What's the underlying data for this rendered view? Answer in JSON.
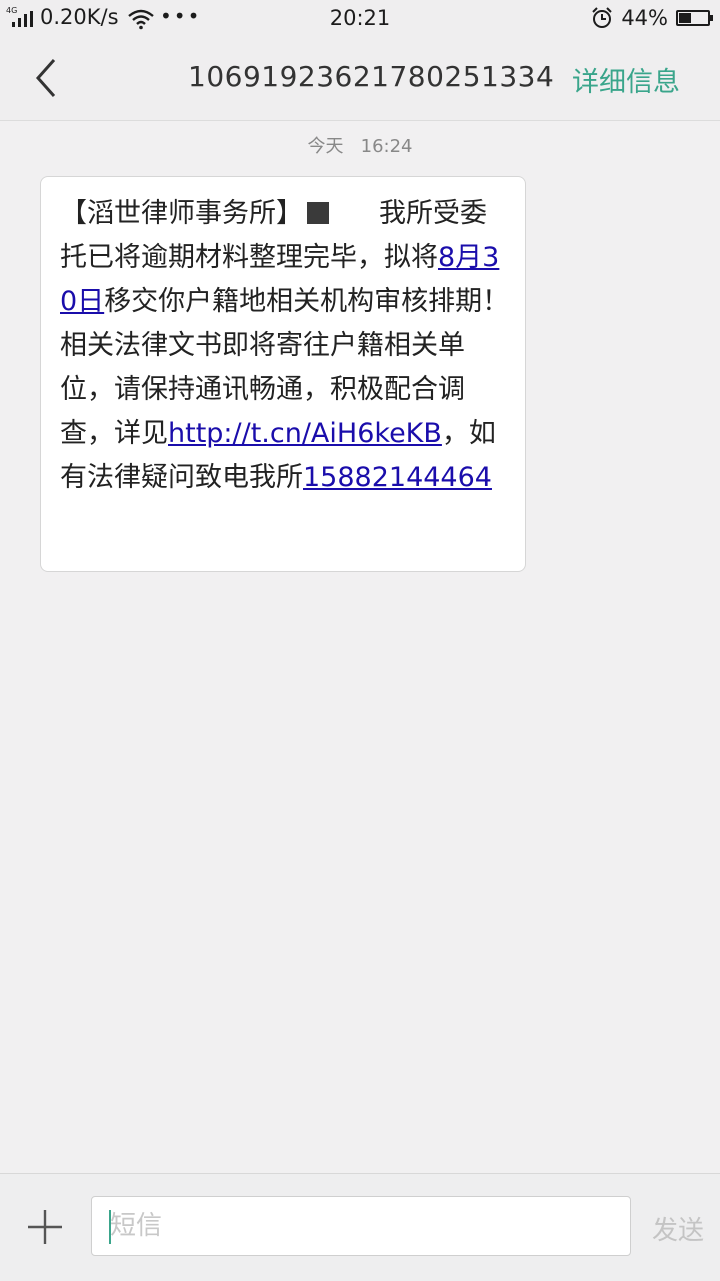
{
  "status_bar": {
    "network": "4G",
    "speed": "0.20K/s",
    "dots": "•••",
    "time": "20:21",
    "battery_text": "44%",
    "battery_level": 0.44,
    "icons": [
      "signal-icon",
      "wifi-icon",
      "alarm-icon",
      "battery-icon"
    ]
  },
  "header": {
    "back_icon": "chevron-left-icon",
    "title": "1069192362178025133​4",
    "details_label": "详细信息",
    "accent_color": "#3aa58b"
  },
  "conversation": {
    "date_label": "今天",
    "time_label": "16:24",
    "message": {
      "prefix": "【滔世律师事务所】",
      "part1": "我所受委托已将逾期材料整理完毕，拟将",
      "date_link": "8月30日",
      "part2": "移交你户籍地相关机构审核排期！相关法律文书即将寄往户籍相关单位，请保持通讯畅通，积极配合调查，详见",
      "url_link": "http://t.cn/AiH6keKB",
      "part3": "，如有法律疑问致电我所",
      "phone_link": "15882144464"
    }
  },
  "composer": {
    "add_icon": "plus-icon",
    "placeholder": "短信",
    "send_label": "发送"
  }
}
